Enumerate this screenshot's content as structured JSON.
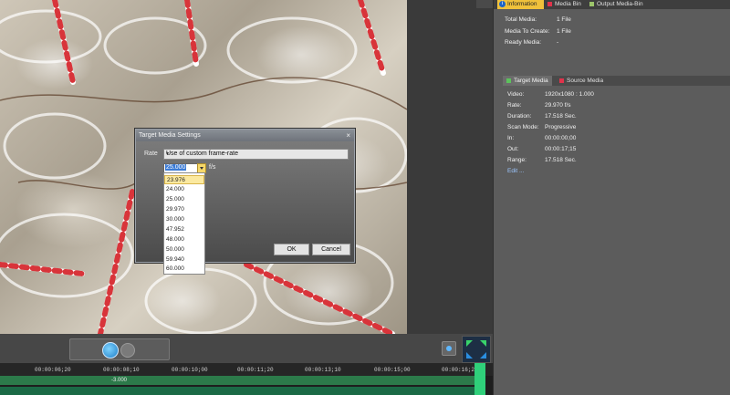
{
  "transport": {
    "play_icon": "play-icon",
    "pause_icon": "pause-icon"
  },
  "timeline": {
    "ticks": [
      "00:00:06;20",
      "00:00:08;10",
      "00:00:10;00",
      "00:00:11;20",
      "00:00:13;10",
      "00:00:15;00",
      "00:00:16;20"
    ],
    "track_label": "-3.000"
  },
  "dialog": {
    "title": "Target Media Settings",
    "rate_label": "Rate",
    "rate_mode": "Use of custom frame-rate",
    "fps_value": "25.000",
    "fps_unit": "f/s",
    "options": [
      "23.976",
      "24.000",
      "25.000",
      "29.970",
      "30.000",
      "47.952",
      "48.000",
      "50.000",
      "59.940",
      "60.000"
    ],
    "ok": "OK",
    "cancel": "Cancel"
  },
  "right_panel": {
    "tabs": [
      {
        "label": "Information",
        "color": "#1d64c8"
      },
      {
        "label": "Media Bin",
        "color": "#e0334b"
      },
      {
        "label": "Output Media-Bin",
        "color": "#9cc46a"
      }
    ],
    "info": [
      {
        "label": "Total Media:",
        "value": "1 File"
      },
      {
        "label": "Media To Create:",
        "value": "1 File"
      },
      {
        "label": "Ready Media:",
        "value": "-"
      }
    ],
    "sub_tabs": [
      {
        "label": "Target Media",
        "color": "#5cc25c"
      },
      {
        "label": "Source Media",
        "color": "#e0334b"
      }
    ],
    "target_media": [
      {
        "label": "Video:",
        "value": "1920x1080 : 1.000"
      },
      {
        "label": "Rate:",
        "value": "29.970 f/s"
      },
      {
        "label": "Duration:",
        "value": "17.518 Sec."
      },
      {
        "label": "Scan Mode:",
        "value": "Progressive"
      },
      {
        "label": "In:",
        "value": "00:00:00;00"
      },
      {
        "label": "Out:",
        "value": "00:00:17;15"
      },
      {
        "label": "Range:",
        "value": "17.518 Sec."
      }
    ],
    "edit_link": "Edit ..."
  }
}
